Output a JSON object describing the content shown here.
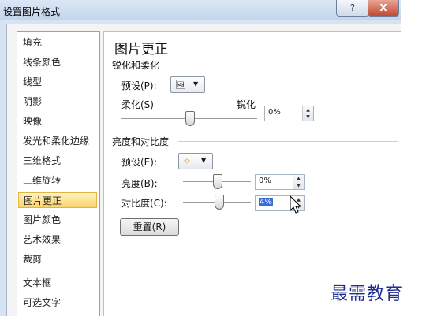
{
  "window": {
    "title": "设置图片格式",
    "help_label": "?",
    "close_label": "X"
  },
  "nav": {
    "items": [
      {
        "label": "填充"
      },
      {
        "label": "线条颜色"
      },
      {
        "label": "线型"
      },
      {
        "label": "阴影"
      },
      {
        "label": "映像"
      },
      {
        "label": "发光和柔化边缘"
      },
      {
        "label": "三维格式"
      },
      {
        "label": "三维旋转"
      },
      {
        "label": "图片更正",
        "selected": true
      },
      {
        "label": "图片颜色"
      },
      {
        "label": "艺术效果"
      },
      {
        "label": "裁剪"
      },
      {
        "label": "文本框"
      },
      {
        "label": "可选文字"
      }
    ]
  },
  "panel": {
    "title": "图片更正",
    "sharpen": {
      "heading": "锐化和柔化",
      "preset_label": "预设(P):",
      "soften_label": "柔化(S)",
      "sharpen_label": "锐化",
      "value": "0%",
      "slider_fraction": 0.5
    },
    "brightness_contrast": {
      "heading": "亮度和对比度",
      "preset_label": "预设(E):",
      "brightness_label": "亮度(B):",
      "brightness_value": "0%",
      "brightness_fraction": 0.5,
      "contrast_label": "对比度(C):",
      "contrast_value": "4%",
      "contrast_fraction": 0.52
    },
    "reset_label": "重置(R)"
  },
  "watermark": "最需教育",
  "colors": {
    "selected_nav_bg": "#fbd36a",
    "title_bar": "#c3d5ec",
    "watermark": "#1f2d8f"
  }
}
